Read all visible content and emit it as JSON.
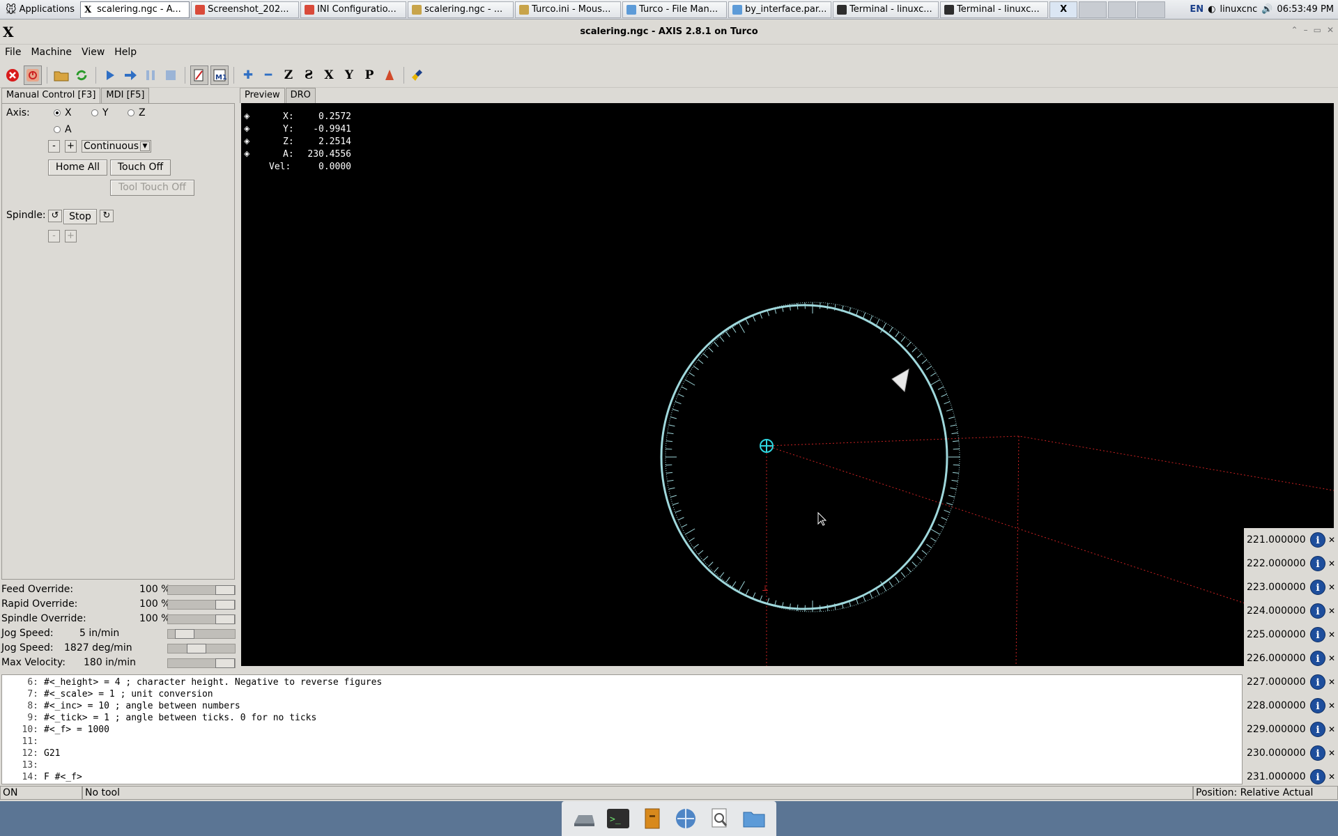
{
  "panel": {
    "apps_label": "Applications",
    "tasks": [
      {
        "label": "scalering.ngc - A...",
        "icon": "x-icon",
        "active": true
      },
      {
        "label": "Screenshot_202...",
        "icon": "chrome-icon"
      },
      {
        "label": "INI Configuratio...",
        "icon": "chrome-icon"
      },
      {
        "label": "scalering.ngc - ...",
        "icon": "editor-icon"
      },
      {
        "label": "Turco.ini - Mous...",
        "icon": "editor-icon"
      },
      {
        "label": "Turco - File Man...",
        "icon": "folder-icon"
      },
      {
        "label": "by_interface.par...",
        "icon": "folder-icon"
      },
      {
        "label": "Terminal - linuxc...",
        "icon": "terminal-icon"
      },
      {
        "label": "Terminal - linuxc...",
        "icon": "terminal-icon"
      }
    ],
    "lang": "EN",
    "user": "linuxcnc",
    "clock": "06:53:49 PM"
  },
  "window": {
    "title": "scalering.ngc - AXIS 2.8.1 on Turco",
    "menus": [
      "File",
      "Machine",
      "View",
      "Help"
    ]
  },
  "left_tabs": [
    "Manual Control [F3]",
    "MDI [F5]"
  ],
  "manual": {
    "axis_label": "Axis:",
    "axes": [
      "X",
      "Y",
      "Z",
      "A"
    ],
    "selected_axis": "X",
    "jog_minus": "-",
    "jog_plus": "+",
    "jog_mode": "Continuous",
    "home_all": "Home All",
    "touch_off": "Touch Off",
    "tool_touch_off": "Tool Touch Off",
    "spindle_label": "Spindle:",
    "spindle_stop": "Stop",
    "spindle_minus": "-",
    "spindle_plus": "+"
  },
  "overrides": [
    {
      "name": "Feed Override:",
      "value": "100 %",
      "level": 1.0
    },
    {
      "name": "Rapid Override:",
      "value": "100 %",
      "level": 1.0
    },
    {
      "name": "Spindle Override:",
      "value": "100 %",
      "level": 1.0
    },
    {
      "name": "Jog Speed:",
      "value": "5 in/min",
      "level": 0.15
    },
    {
      "name": "Jog Speed:",
      "value": "1827 deg/min",
      "level": 0.4
    },
    {
      "name": "Max Velocity:",
      "value": "180 in/min",
      "level": 1.0
    }
  ],
  "right_tabs": [
    "Preview",
    "DRO"
  ],
  "dro": [
    {
      "label": "X:",
      "value": "0.2572"
    },
    {
      "label": "Y:",
      "value": "-0.9941"
    },
    {
      "label": "Z:",
      "value": "2.2514"
    },
    {
      "label": "A:",
      "value": "230.4556"
    },
    {
      "label": "Vel:",
      "value": "0.0000"
    }
  ],
  "meters": [
    "221.000000",
    "222.000000",
    "223.000000",
    "224.000000",
    "225.000000",
    "226.000000",
    "227.000000",
    "228.000000",
    "229.000000",
    "230.000000",
    "231.000000"
  ],
  "gcode": [
    {
      "n": "6:",
      "text": "#<_height> = 4 ; character height. Negative to reverse figures"
    },
    {
      "n": "7:",
      "text": "#<_scale> = 1 ; unit conversion"
    },
    {
      "n": "8:",
      "text": "#<_inc> = 10 ; angle between numbers"
    },
    {
      "n": "9:",
      "text": "#<_tick> = 1 ; angle between ticks. 0 for no ticks"
    },
    {
      "n": "10:",
      "text": "#<_f> = 1000"
    },
    {
      "n": "11:",
      "text": ""
    },
    {
      "n": "12:",
      "text": "G21"
    },
    {
      "n": "13:",
      "text": ""
    },
    {
      "n": "14:",
      "text": "F #<_f>"
    }
  ],
  "status": {
    "state": "ON",
    "tool": "No tool",
    "position": "Position: Relative Actual"
  },
  "colors": {
    "toolpath": "#9fd8dc",
    "rapid": "#cc2222",
    "preview_bg": "#000000"
  }
}
